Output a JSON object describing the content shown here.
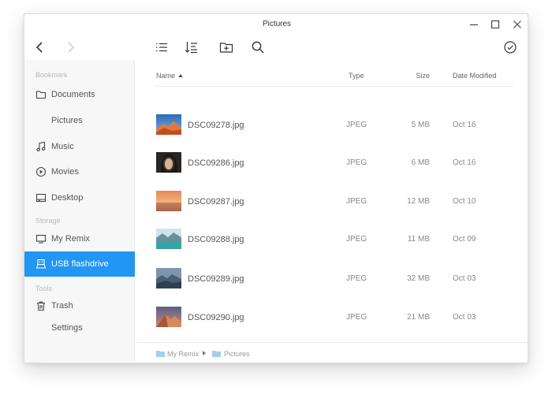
{
  "window": {
    "title": "Pictures"
  },
  "toolbar": {
    "back": "chevron-left-icon",
    "forward": "chevron-right-icon",
    "list_view": "list-icon",
    "sort": "sort-icon",
    "new_folder": "new-folder-icon",
    "search": "search-icon",
    "select": "check-circle-icon"
  },
  "sidebar": {
    "sections": [
      "Bookmark",
      "Storage",
      "Tools"
    ],
    "items": [
      {
        "label": "Documents",
        "icon": "folder-icon"
      },
      {
        "label": "Pictures",
        "icon": ""
      },
      {
        "label": "Music",
        "icon": "music-note-icon"
      },
      {
        "label": "Movies",
        "icon": "play-circle-icon"
      },
      {
        "label": "Desktop",
        "icon": "desktop-icon"
      },
      {
        "label": "My Remix",
        "icon": "monitor-icon"
      },
      {
        "label": "USB flashdrive",
        "icon": "usb-drive-icon",
        "active": true
      },
      {
        "label": "Trash",
        "icon": "trash-icon"
      },
      {
        "label": "Settings",
        "icon": ""
      }
    ],
    "accent": "#2196f3"
  },
  "columns": {
    "name": "Name",
    "type": "Type",
    "size": "Size",
    "date": "Date Modified"
  },
  "files": [
    {
      "name": "DSC09278.jpg",
      "type": "JPEG",
      "size": "5 MB",
      "date": "Oct 16"
    },
    {
      "name": "DSC09286.jpg",
      "type": "JPEG",
      "size": "6 MB",
      "date": "Oct 16"
    },
    {
      "name": "DSC09287.jpg",
      "type": "JPEG",
      "size": "12 MB",
      "date": "Oct 10"
    },
    {
      "name": "DSC09288.jpg",
      "type": "JPEG",
      "size": "11 MB",
      "date": "Oct 09"
    },
    {
      "name": "DSC09289.jpg",
      "type": "JPEG",
      "size": "32 MB",
      "date": "Oct 03"
    },
    {
      "name": "DSC09290.jpg",
      "type": "JPEG",
      "size": "21 MB",
      "date": "Oct 03"
    }
  ],
  "breadcrumb": [
    "My Remix",
    "Pictures"
  ]
}
